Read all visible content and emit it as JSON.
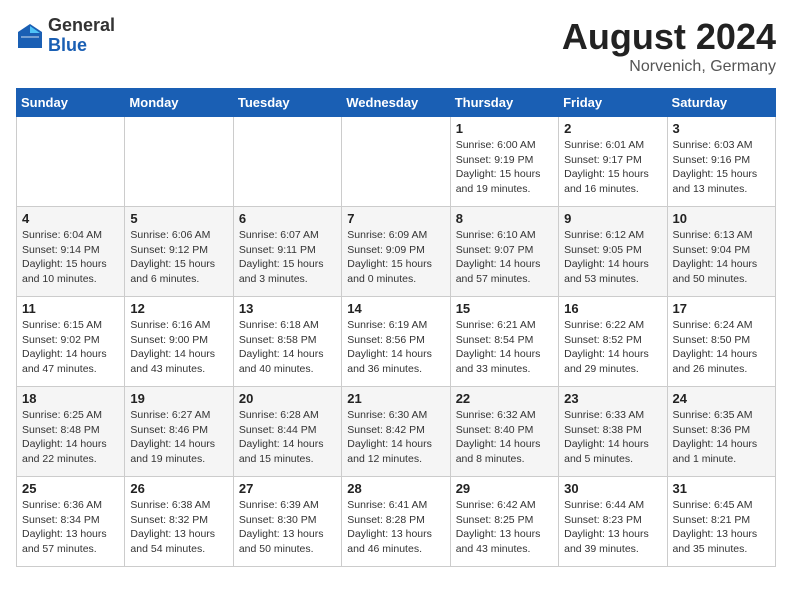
{
  "header": {
    "logo_general": "General",
    "logo_blue": "Blue",
    "title": "August 2024",
    "location": "Norvenich, Germany"
  },
  "days_of_week": [
    "Sunday",
    "Monday",
    "Tuesday",
    "Wednesday",
    "Thursday",
    "Friday",
    "Saturday"
  ],
  "weeks": [
    [
      {
        "day": "",
        "text": ""
      },
      {
        "day": "",
        "text": ""
      },
      {
        "day": "",
        "text": ""
      },
      {
        "day": "",
        "text": ""
      },
      {
        "day": "1",
        "text": "Sunrise: 6:00 AM\nSunset: 9:19 PM\nDaylight: 15 hours\nand 19 minutes."
      },
      {
        "day": "2",
        "text": "Sunrise: 6:01 AM\nSunset: 9:17 PM\nDaylight: 15 hours\nand 16 minutes."
      },
      {
        "day": "3",
        "text": "Sunrise: 6:03 AM\nSunset: 9:16 PM\nDaylight: 15 hours\nand 13 minutes."
      }
    ],
    [
      {
        "day": "4",
        "text": "Sunrise: 6:04 AM\nSunset: 9:14 PM\nDaylight: 15 hours\nand 10 minutes."
      },
      {
        "day": "5",
        "text": "Sunrise: 6:06 AM\nSunset: 9:12 PM\nDaylight: 15 hours\nand 6 minutes."
      },
      {
        "day": "6",
        "text": "Sunrise: 6:07 AM\nSunset: 9:11 PM\nDaylight: 15 hours\nand 3 minutes."
      },
      {
        "day": "7",
        "text": "Sunrise: 6:09 AM\nSunset: 9:09 PM\nDaylight: 15 hours\nand 0 minutes."
      },
      {
        "day": "8",
        "text": "Sunrise: 6:10 AM\nSunset: 9:07 PM\nDaylight: 14 hours\nand 57 minutes."
      },
      {
        "day": "9",
        "text": "Sunrise: 6:12 AM\nSunset: 9:05 PM\nDaylight: 14 hours\nand 53 minutes."
      },
      {
        "day": "10",
        "text": "Sunrise: 6:13 AM\nSunset: 9:04 PM\nDaylight: 14 hours\nand 50 minutes."
      }
    ],
    [
      {
        "day": "11",
        "text": "Sunrise: 6:15 AM\nSunset: 9:02 PM\nDaylight: 14 hours\nand 47 minutes."
      },
      {
        "day": "12",
        "text": "Sunrise: 6:16 AM\nSunset: 9:00 PM\nDaylight: 14 hours\nand 43 minutes."
      },
      {
        "day": "13",
        "text": "Sunrise: 6:18 AM\nSunset: 8:58 PM\nDaylight: 14 hours\nand 40 minutes."
      },
      {
        "day": "14",
        "text": "Sunrise: 6:19 AM\nSunset: 8:56 PM\nDaylight: 14 hours\nand 36 minutes."
      },
      {
        "day": "15",
        "text": "Sunrise: 6:21 AM\nSunset: 8:54 PM\nDaylight: 14 hours\nand 33 minutes."
      },
      {
        "day": "16",
        "text": "Sunrise: 6:22 AM\nSunset: 8:52 PM\nDaylight: 14 hours\nand 29 minutes."
      },
      {
        "day": "17",
        "text": "Sunrise: 6:24 AM\nSunset: 8:50 PM\nDaylight: 14 hours\nand 26 minutes."
      }
    ],
    [
      {
        "day": "18",
        "text": "Sunrise: 6:25 AM\nSunset: 8:48 PM\nDaylight: 14 hours\nand 22 minutes."
      },
      {
        "day": "19",
        "text": "Sunrise: 6:27 AM\nSunset: 8:46 PM\nDaylight: 14 hours\nand 19 minutes."
      },
      {
        "day": "20",
        "text": "Sunrise: 6:28 AM\nSunset: 8:44 PM\nDaylight: 14 hours\nand 15 minutes."
      },
      {
        "day": "21",
        "text": "Sunrise: 6:30 AM\nSunset: 8:42 PM\nDaylight: 14 hours\nand 12 minutes."
      },
      {
        "day": "22",
        "text": "Sunrise: 6:32 AM\nSunset: 8:40 PM\nDaylight: 14 hours\nand 8 minutes."
      },
      {
        "day": "23",
        "text": "Sunrise: 6:33 AM\nSunset: 8:38 PM\nDaylight: 14 hours\nand 5 minutes."
      },
      {
        "day": "24",
        "text": "Sunrise: 6:35 AM\nSunset: 8:36 PM\nDaylight: 14 hours\nand 1 minute."
      }
    ],
    [
      {
        "day": "25",
        "text": "Sunrise: 6:36 AM\nSunset: 8:34 PM\nDaylight: 13 hours\nand 57 minutes."
      },
      {
        "day": "26",
        "text": "Sunrise: 6:38 AM\nSunset: 8:32 PM\nDaylight: 13 hours\nand 54 minutes."
      },
      {
        "day": "27",
        "text": "Sunrise: 6:39 AM\nSunset: 8:30 PM\nDaylight: 13 hours\nand 50 minutes."
      },
      {
        "day": "28",
        "text": "Sunrise: 6:41 AM\nSunset: 8:28 PM\nDaylight: 13 hours\nand 46 minutes."
      },
      {
        "day": "29",
        "text": "Sunrise: 6:42 AM\nSunset: 8:25 PM\nDaylight: 13 hours\nand 43 minutes."
      },
      {
        "day": "30",
        "text": "Sunrise: 6:44 AM\nSunset: 8:23 PM\nDaylight: 13 hours\nand 39 minutes."
      },
      {
        "day": "31",
        "text": "Sunrise: 6:45 AM\nSunset: 8:21 PM\nDaylight: 13 hours\nand 35 minutes."
      }
    ]
  ]
}
